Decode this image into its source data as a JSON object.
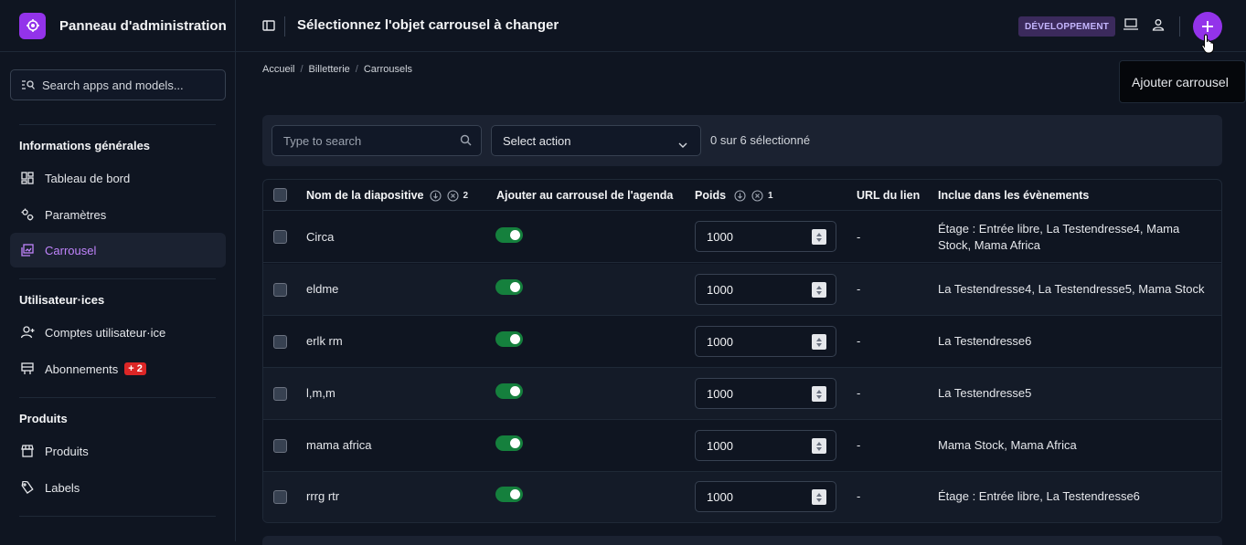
{
  "brand": {
    "title": "Panneau d'administration"
  },
  "sidebar": {
    "search_placeholder": "Search apps and models...",
    "sections": [
      {
        "title": "Informations générales",
        "items": [
          {
            "label": "Tableau de bord",
            "icon": "dashboard-icon"
          },
          {
            "label": "Paramètres",
            "icon": "settings-icon"
          },
          {
            "label": "Carrousel",
            "icon": "carousel-icon",
            "active": true
          }
        ]
      },
      {
        "title": "Utilisateur·ices",
        "items": [
          {
            "label": "Comptes utilisateur·ice",
            "icon": "user-add-icon"
          },
          {
            "label": "Abonnements",
            "icon": "subscription-icon",
            "badge": "+ 2"
          }
        ]
      },
      {
        "title": "Produits",
        "items": [
          {
            "label": "Produits",
            "icon": "store-icon"
          },
          {
            "label": "Labels",
            "icon": "label-icon"
          }
        ]
      }
    ]
  },
  "header": {
    "title": "Sélectionnez l'objet carrousel à changer",
    "env_badge": "DÉVELOPPEMENT",
    "add_tooltip": "Ajouter carrousel"
  },
  "breadcrumb": [
    "Accueil",
    "Billetterie",
    "Carrousels"
  ],
  "toolbar": {
    "search_placeholder": "Type to search",
    "action_label": "Select action",
    "selection_count": "0 sur 6 sélectionné"
  },
  "table": {
    "columns": {
      "name": "Nom de la diapositive",
      "name_sort": "2",
      "agenda": "Ajouter au carrousel de l'agenda",
      "weight": "Poids",
      "weight_sort": "1",
      "url": "URL du lien",
      "events": "Inclue dans les évènements"
    },
    "rows": [
      {
        "name": "Circa",
        "agenda": true,
        "weight": "1000",
        "url": "-",
        "events_line1": "Étage : Entrée libre, La Testendresse4, Mama",
        "events_line2": "Stock, Mama Africa"
      },
      {
        "name": "eldme",
        "agenda": true,
        "weight": "1000",
        "url": "-",
        "events_line1": "La Testendresse4, La Testendresse5, Mama Stock",
        "events_line2": ""
      },
      {
        "name": "erlk rm",
        "agenda": true,
        "weight": "1000",
        "url": "-",
        "events_line1": "La Testendresse6",
        "events_line2": ""
      },
      {
        "name": "l,m,m",
        "agenda": true,
        "weight": "1000",
        "url": "-",
        "events_line1": "La Testendresse5",
        "events_line2": ""
      },
      {
        "name": "mama africa",
        "agenda": true,
        "weight": "1000",
        "url": "-",
        "events_line1": "Mama Stock, Mama Africa",
        "events_line2": ""
      },
      {
        "name": "rrrg rtr",
        "agenda": true,
        "weight": "1000",
        "url": "-",
        "events_line1": "Étage : Entrée libre, La Testendresse6",
        "events_line2": ""
      }
    ]
  },
  "colors": {
    "accent": "#9333ea",
    "toggle_on": "#15803d",
    "badge_red": "#dc2626"
  }
}
